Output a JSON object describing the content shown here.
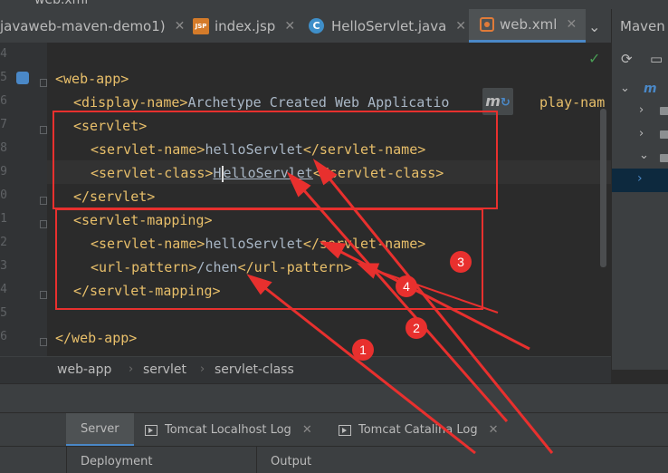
{
  "window": {
    "partial_title": "web.xml"
  },
  "tabs": [
    {
      "label": "javaweb-maven-demo1)"
    },
    {
      "label": "index.jsp",
      "icon": "jsp-file-icon"
    },
    {
      "label": "HelloServlet.java",
      "icon": "java-class-icon"
    },
    {
      "label": "web.xml",
      "icon": "xml-file-icon",
      "active": true
    }
  ],
  "maven_panel": {
    "title": "Maven",
    "selected_label": "m"
  },
  "gutter_numbers": [
    "4",
    "5",
    "6",
    "7",
    "8",
    "9",
    "0",
    "1",
    "2",
    "3",
    "4",
    "5",
    "6"
  ],
  "code": {
    "l1_open": "<web-app>",
    "l2_open": "<display-name>",
    "l2_text": "Archetype Created Web Applicatio",
    "l2_tail": "play-nam",
    "l3": "<servlet>",
    "l4_open": "<servlet-name>",
    "l4_text": "helloServlet",
    "l4_close": "</servlet-name>",
    "l5_open": "<servlet-class>",
    "l5_text_a": "H",
    "l5_text_b": "elloServlet",
    "l5_close": "</servlet-class>",
    "l6": "</servlet>",
    "l7": "<servlet-mapping>",
    "l8_open": "<servlet-name>",
    "l8_text": "helloServlet",
    "l8_close": "</servlet-name>",
    "l9_open": "<url-pattern>",
    "l9_text": "/chen",
    "l9_close": "</url-pattern>",
    "l10": "</servlet-mapping>",
    "l12": "</web-app>"
  },
  "breadcrumb": [
    "web-app",
    "servlet",
    "servlet-class"
  ],
  "bottom_tabs": [
    {
      "label": "Server",
      "active": true
    },
    {
      "label": "Tomcat Localhost Log"
    },
    {
      "label": "Tomcat Catalina Log"
    }
  ],
  "bottom_panel": {
    "col1": "Deployment",
    "col2": "Output"
  },
  "annotations": {
    "markers": [
      "1",
      "2",
      "3",
      "4"
    ],
    "color": "#e8302e"
  },
  "colors": {
    "editor_bg": "#2b2b2b",
    "tag": "#e8bf6a",
    "text": "#a9b7c6",
    "accent": "#4a88c7"
  }
}
